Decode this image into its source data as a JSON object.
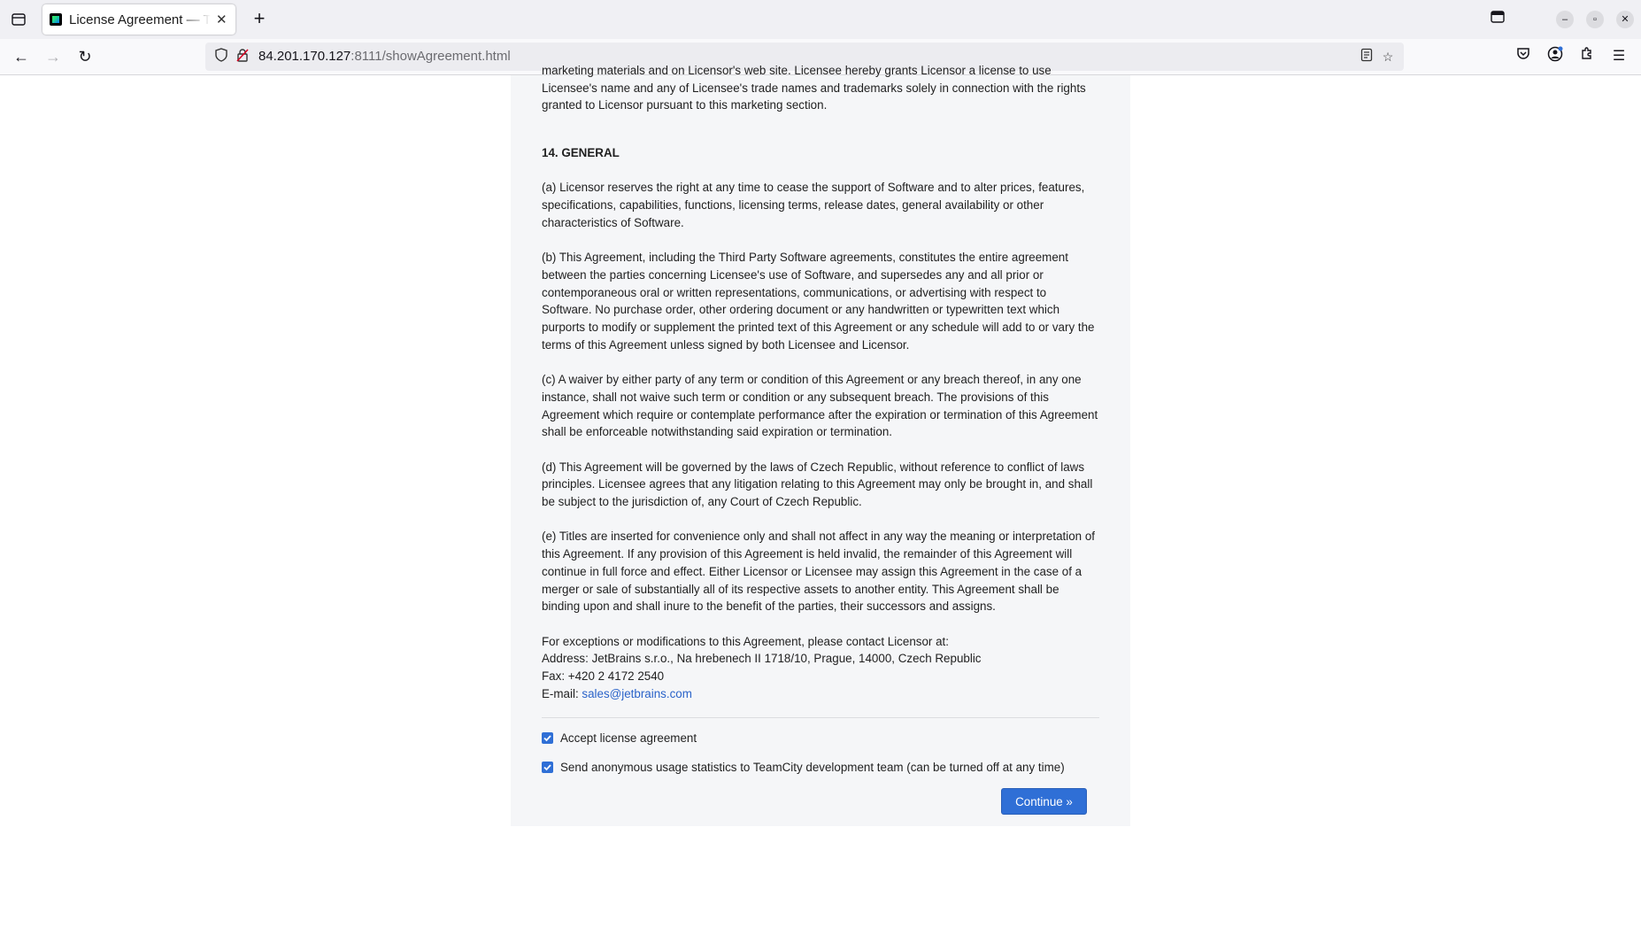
{
  "browser": {
    "tab_title": "License Agreement — TeamCity",
    "url_host": "84.201.170.127",
    "url_rest": ":8111/showAgreement.html"
  },
  "agreement": {
    "fade_text": "marketing materials and on Licensor's web site. Licensee hereby grants Licensor a license to use Licensee's name and any of Licensee's trade names and trademarks solely in connection with the rights granted to Licensor pursuant to this marketing section.",
    "section_title": "14. GENERAL",
    "paragraphs": [
      "(a) Licensor reserves the right at any time to cease the support of Software and to alter prices, features, specifications, capabilities, functions, licensing terms, release dates, general availability or other characteristics of Software.",
      "(b) This Agreement, including the Third Party Software agreements, constitutes the entire agreement between the parties concerning Licensee's use of Software, and supersedes any and all prior or contemporaneous oral or written representations, communications, or advertising with respect to Software. No purchase order, other ordering document or any handwritten or typewritten text which purports to modify or supplement the printed text of this Agreement or any schedule will add to or vary the terms of this Agreement unless signed by both Licensee and Licensor.",
      "(c) A waiver by either party of any term or condition of this Agreement or any breach thereof, in any one instance, shall not waive such term or condition or any subsequent breach. The provisions of this Agreement which require or contemplate performance after the expiration or termination of this Agreement shall be enforceable notwithstanding said expiration or termination.",
      "(d) This Agreement will be governed by the laws of Czech Republic, without reference to conflict of laws principles. Licensee agrees that any litigation relating to this Agreement may only be brought in, and shall be subject to the jurisdiction of, any Court of Czech Republic.",
      "(e) Titles are inserted for convenience only and shall not affect in any way the meaning or interpretation of this Agreement. If any provision of this Agreement is held invalid, the remainder of this Agreement will continue in full force and effect. Either Licensor or Licensee may assign this Agreement in the case of a merger or sale of substantially all of its respective assets to another entity. This Agreement shall be binding upon and shall inure to the benefit of the parties, their successors and assigns."
    ],
    "contact": {
      "intro": "For exceptions or modifications to this Agreement, please contact Licensor at:",
      "address": "Address: JetBrains s.r.o., Na hrebenech II 1718/10, Prague, 14000, Czech Republic",
      "fax": "Fax: +420 2 4172 2540",
      "email_label": "E-mail: ",
      "email": "sales@jetbrains.com"
    }
  },
  "form": {
    "accept_label": "Accept license agreement",
    "accept_checked": true,
    "stats_label": "Send anonymous usage statistics to TeamCity development team (can be turned off at any time)",
    "stats_checked": true,
    "continue_label": "Continue »"
  },
  "colors": {
    "accent": "#2f6fd6",
    "link": "#2a63c9",
    "panel_bg": "#f5f6f8"
  }
}
